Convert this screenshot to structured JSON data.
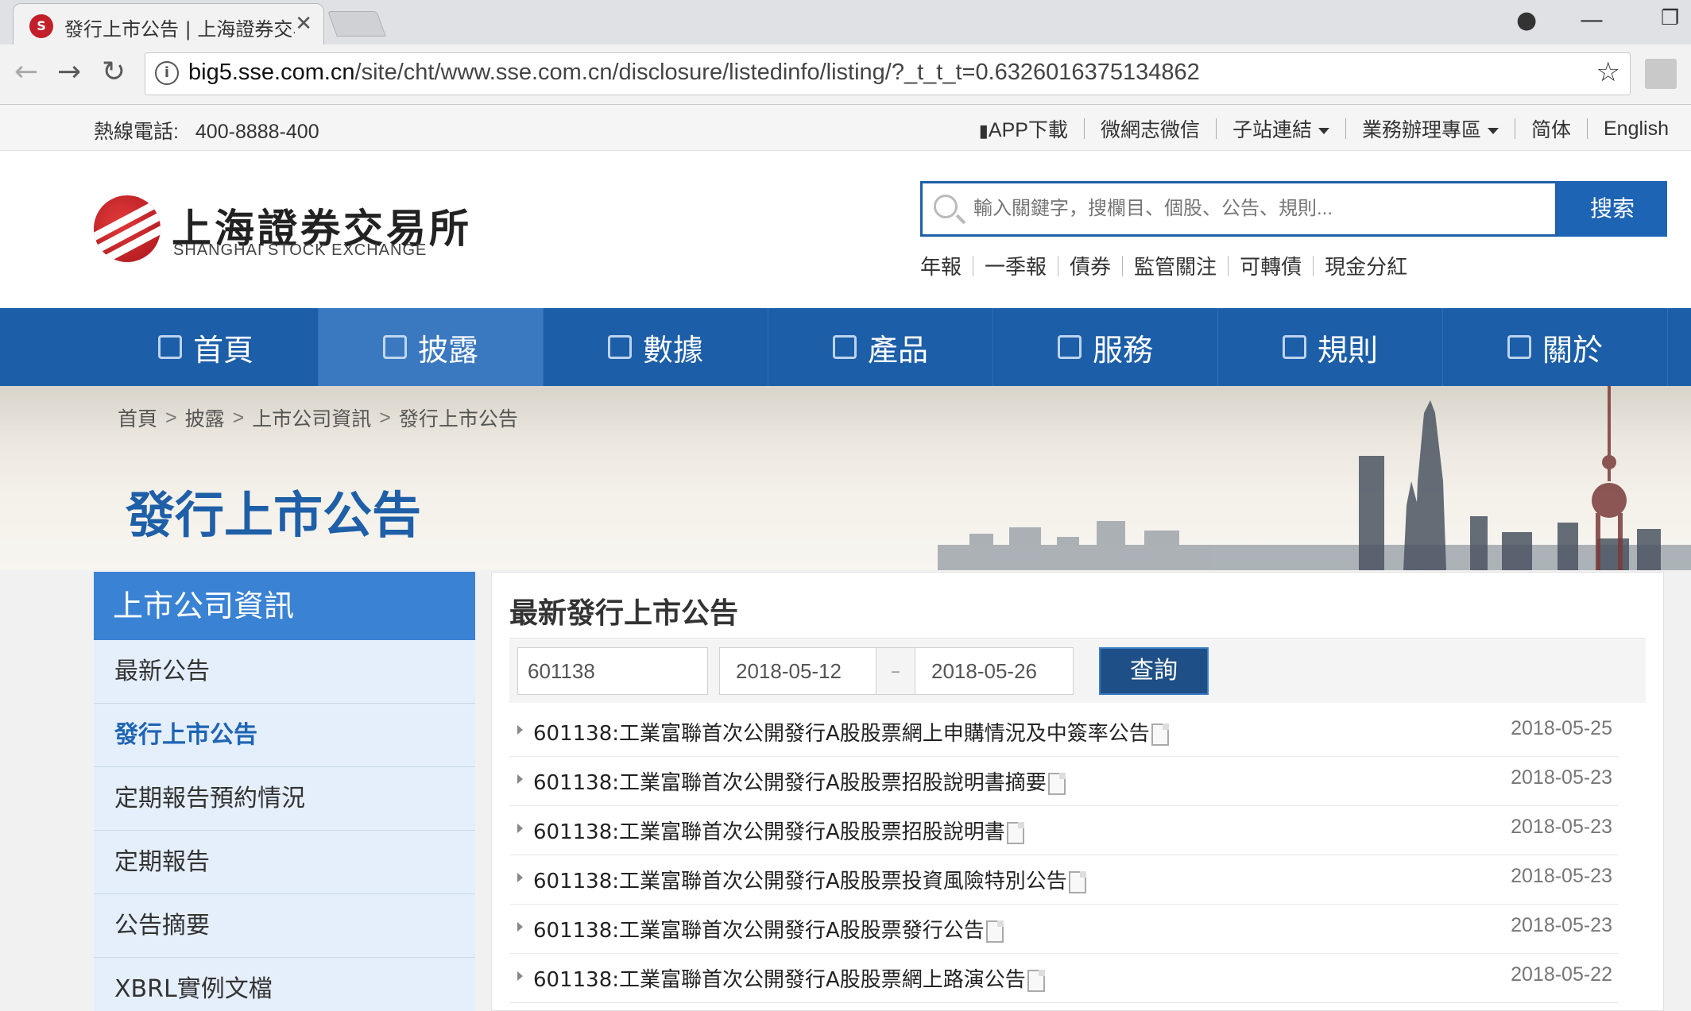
{
  "browser": {
    "tab_title": "發行上市公告 | 上海證券交易所",
    "favicon_text": "S",
    "close_glyph": "✕",
    "url_host": "big5.sse.com.cn",
    "url_path": "/site/cht/www.sse.com.cn/disclosure/listedinfo/listing/?_t_t_t=0.6326016375134862",
    "info_glyph": "i",
    "star_glyph": "☆",
    "back_glyph": "←",
    "forward_glyph": "→",
    "reload_glyph": "↻",
    "account_glyph": "●",
    "minimize_glyph": "—",
    "restore_glyph": "❐"
  },
  "topbar": {
    "hotline_label": "熱線電話:",
    "hotline_number": "400-8888-400",
    "links": {
      "app": "APP下載",
      "weibo": "微網志微信",
      "subsites": "子站連結",
      "business": "業務辦理專區",
      "simplified": "简体",
      "english": "English"
    }
  },
  "header": {
    "logo_cn": "上海證券交易所",
    "logo_en": "SHANGHAI STOCK EXCHANGE",
    "search_placeholder": "輸入關鍵字，搜欄目、個股、公告、規則...",
    "search_button": "搜索",
    "hotwords": [
      "年報",
      "一季報",
      "債券",
      "監管關注",
      "可轉債",
      "現金分紅"
    ]
  },
  "mainnav": {
    "items": [
      "首頁",
      "披露",
      "數據",
      "產品",
      "服務",
      "規則",
      "關於"
    ],
    "active_index": 1
  },
  "banner": {
    "breadcrumb": [
      "首頁",
      "披露",
      "上市公司資訊",
      "發行上市公告"
    ],
    "chevron": ">",
    "title": "發行上市公告"
  },
  "sidebar": {
    "heading": "上市公司資訊",
    "items": [
      "最新公告",
      "發行上市公告",
      "定期報告預約情況",
      "定期報告",
      "公告摘要",
      "XBRL實例文檔"
    ],
    "active_index": 1
  },
  "panel": {
    "title": "最新發行上市公告",
    "filter": {
      "code_value": "601138",
      "date_from": "2018-05-12",
      "date_sep": "–",
      "date_to": "2018-05-26",
      "query_button": "查詢"
    },
    "announcements": [
      {
        "title": "601138:工業富聯首次公開發行A股股票網上申購情況及中簽率公告",
        "date": "2018-05-25"
      },
      {
        "title": "601138:工業富聯首次公開發行A股股票招股說明書摘要",
        "date": "2018-05-23"
      },
      {
        "title": "601138:工業富聯首次公開發行A股股票招股說明書",
        "date": "2018-05-23"
      },
      {
        "title": "601138:工業富聯首次公開發行A股股票投資風險特別公告",
        "date": "2018-05-23"
      },
      {
        "title": "601138:工業富聯首次公開發行A股股票發行公告",
        "date": "2018-05-23"
      },
      {
        "title": "601138:工業富聯首次公開發行A股股票網上路演公告",
        "date": "2018-05-22"
      }
    ]
  },
  "colors": {
    "nav_blue": "#1c5ea8",
    "nav_active": "#3a78c0",
    "title_blue": "#1e5fa8",
    "sidebar_head": "#3a82d4",
    "sidebar_bg": "#e4effb",
    "query_btn": "#1e4f86"
  }
}
